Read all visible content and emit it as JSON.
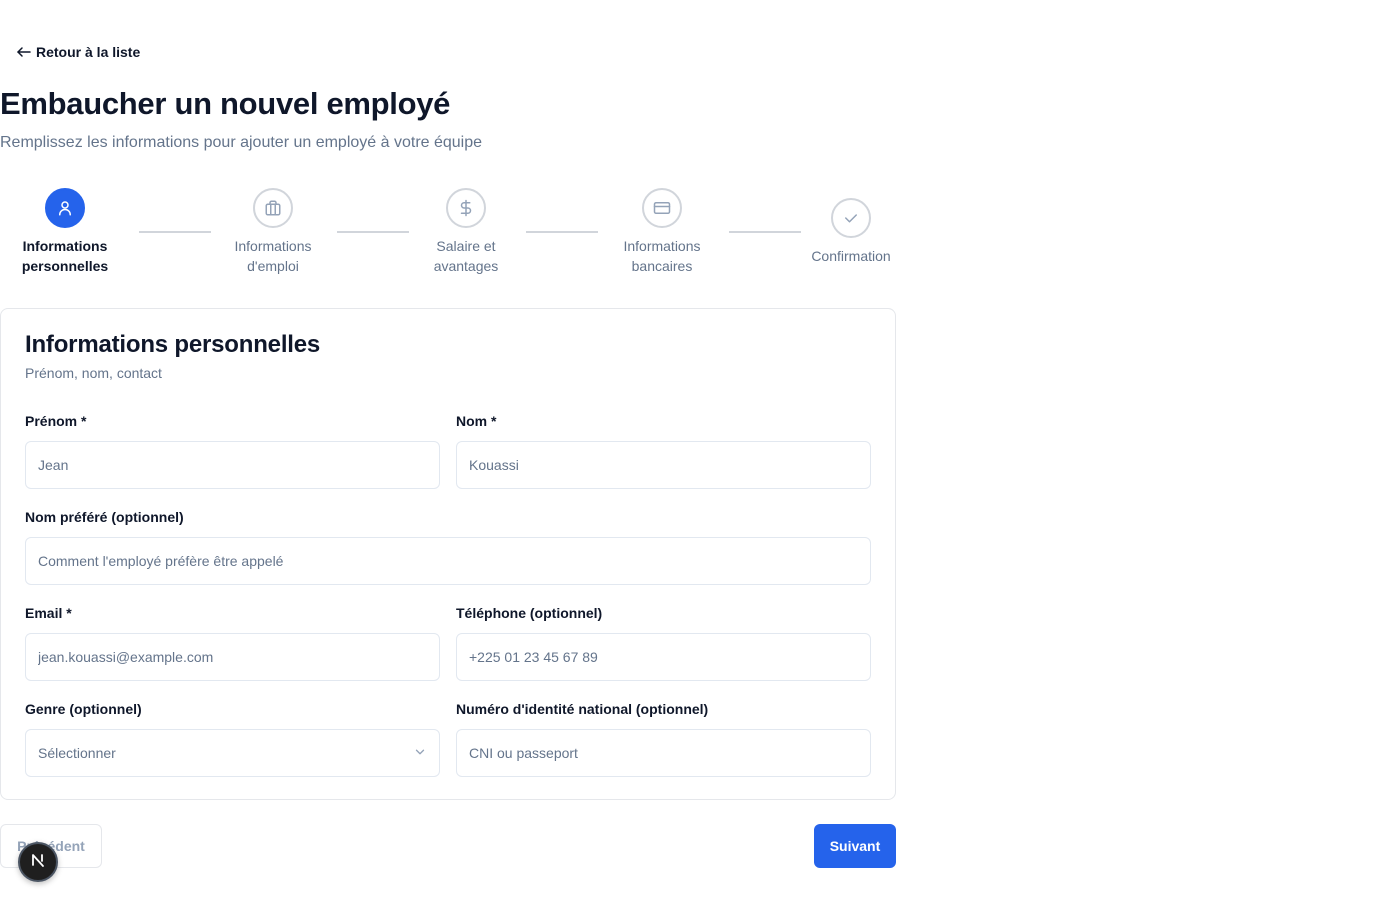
{
  "nav": {
    "back_label": "Retour à la liste"
  },
  "header": {
    "title": "Embaucher un nouvel employé",
    "subtitle": "Remplissez les informations pour ajouter un employé à votre équipe"
  },
  "stepper": {
    "current_step": 1,
    "steps": [
      {
        "label": "Informations personnelles",
        "icon": "user-icon",
        "status": "active"
      },
      {
        "label": "Informations d'emploi",
        "icon": "briefcase-icon",
        "status": "pending"
      },
      {
        "label": "Salaire et avantages",
        "icon": "dollar-icon",
        "status": "pending"
      },
      {
        "label": "Informations bancaires",
        "icon": "credit-card-icon",
        "status": "pending"
      },
      {
        "label": "Confirmation",
        "icon": "check-icon",
        "status": "pending"
      }
    ]
  },
  "card": {
    "title": "Informations personnelles",
    "subtitle": "Prénom, nom, contact",
    "fields": {
      "first_name": {
        "label": "Prénom *",
        "placeholder": "Jean",
        "value": ""
      },
      "last_name": {
        "label": "Nom *",
        "placeholder": "Kouassi",
        "value": ""
      },
      "preferred_name": {
        "label": "Nom préféré (optionnel)",
        "placeholder": "Comment l'employé préfère être appelé",
        "value": ""
      },
      "email": {
        "label": "Email *",
        "placeholder": "jean.kouassi@example.com",
        "value": ""
      },
      "phone": {
        "label": "Téléphone (optionnel)",
        "placeholder": "+225 01 23 45 67 89",
        "value": ""
      },
      "gender": {
        "label": "Genre (optionnel)",
        "selected": "Sélectionner"
      },
      "national_id": {
        "label": "Numéro d'identité national (optionnel)",
        "placeholder": "CNI ou passeport",
        "value": ""
      }
    }
  },
  "footer": {
    "prev_label": "Précédent",
    "next_label": "Suivant"
  },
  "colors": {
    "accent": "#2563eb",
    "muted": "#64748b",
    "border": "#e2e8f0"
  }
}
